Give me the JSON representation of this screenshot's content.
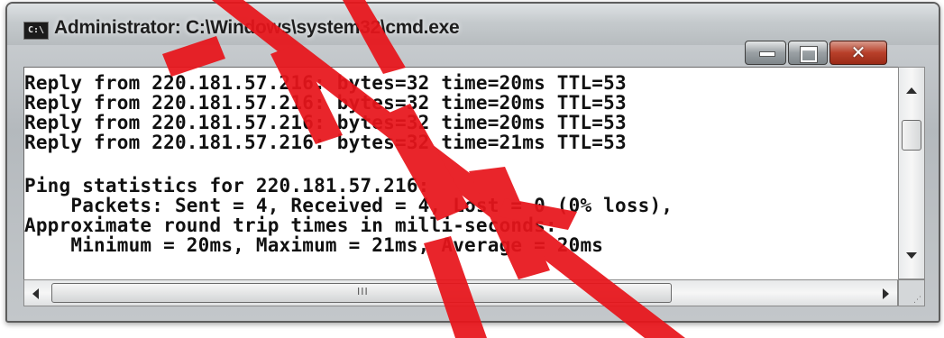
{
  "window": {
    "title": "Administrator: C:\\Windows\\system32\\cmd.exe",
    "icon_text": "C:\\",
    "icon": "cmd-window-icon"
  },
  "controls": {
    "minimize_icon": "minimize-icon",
    "maximize_icon": "maximize-icon",
    "close_glyph": "✕"
  },
  "console": {
    "lines": [
      "Reply from 220.181.57.216: bytes=32 time=20ms TTL=53",
      "Reply from 220.181.57.216: bytes=32 time=20ms TTL=53",
      "Reply from 220.181.57.216: bytes=32 time=20ms TTL=53",
      "Reply from 220.181.57.216: bytes=32 time=21ms TTL=53",
      "",
      "Ping statistics for 220.181.57.216:",
      "    Packets: Sent = 4, Received = 4, Lost = 0 (0% loss),",
      "Approximate round trip times in milli-seconds:",
      "    Minimum = 20ms, Maximum = 21ms, Average = 20ms"
    ]
  },
  "scrollbars": {
    "h_thumb_grip": "III"
  },
  "colors": {
    "console_text": "#111111",
    "console_bg": "#ffffff",
    "close_button": "#b8402a",
    "watermark": "#e8151b"
  }
}
